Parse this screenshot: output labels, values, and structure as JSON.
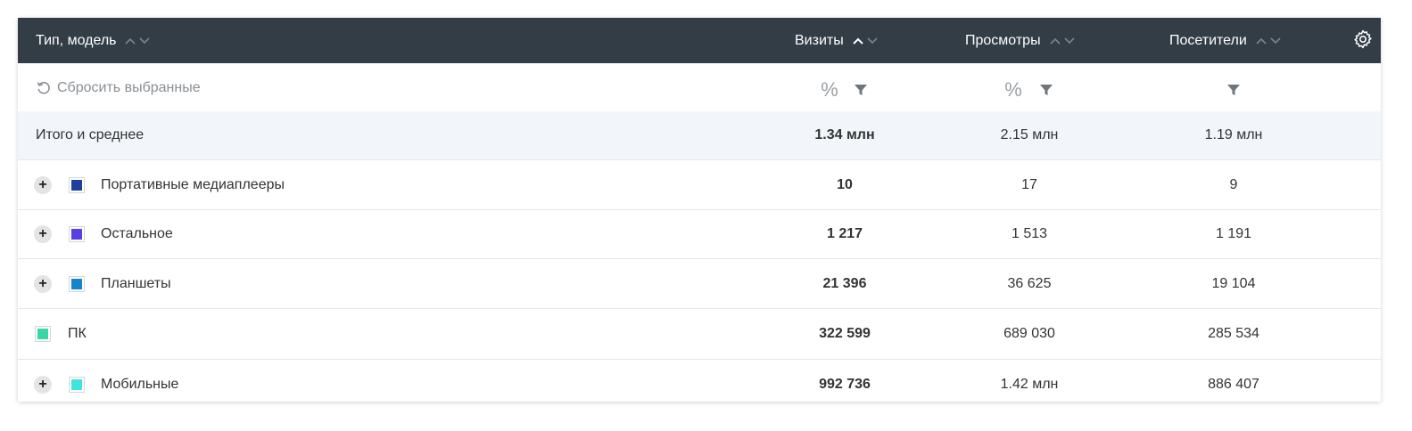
{
  "header": {
    "type_model": "Тип, модель",
    "visits": "Визиты",
    "views": "Просмотры",
    "visitors": "Посетители"
  },
  "toolbar": {
    "reset_label": "Сбросить выбранные",
    "pct_symbol": "%"
  },
  "totals": {
    "label": "Итого и среднее",
    "visits": "1.34 млн",
    "views": "2.15 млн",
    "visitors": "1.19 млн"
  },
  "rows": [
    {
      "label": "Портативные медиаплееры",
      "color": "#1e3f9e",
      "visits": "10",
      "views": "17",
      "visitors": "9"
    },
    {
      "label": "Остальное",
      "color": "#5b3fe0",
      "visits": "1 217",
      "views": "1 513",
      "visitors": "1 191"
    },
    {
      "label": "Планшеты",
      "color": "#1484cc",
      "visits": "21 396",
      "views": "36 625",
      "visitors": "19 104"
    },
    {
      "label": "ПК",
      "color": "#36d9a6",
      "visits": "322 599",
      "views": "689 030",
      "visitors": "285 534"
    },
    {
      "label": "Мобильные",
      "color": "#3fe3e0",
      "visits": "992 736",
      "views": "1.42 млн",
      "visitors": "886 407"
    }
  ]
}
